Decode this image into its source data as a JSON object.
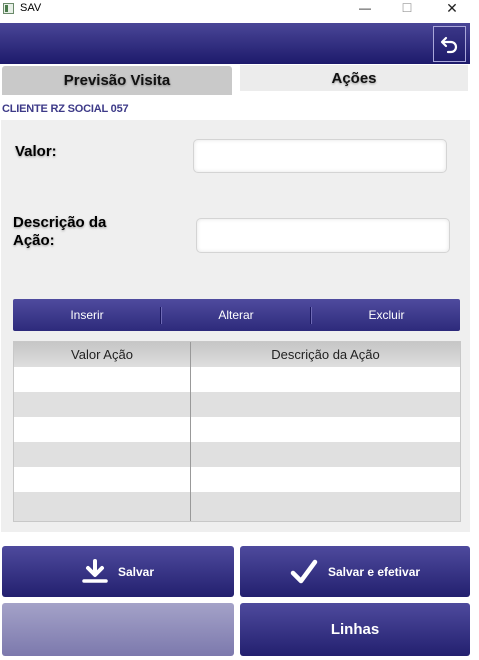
{
  "window": {
    "title": "SAV",
    "minimize": "—",
    "maximize": "☐",
    "close": "✕"
  },
  "header": {
    "back_icon": "undo-arrow-icon"
  },
  "tabs": [
    {
      "label": "Previsão Visita"
    },
    {
      "label": "Ações"
    }
  ],
  "client_name": "CLIENTE RZ SOCIAL 057",
  "form": {
    "valor_label": "Valor:",
    "valor_value": "",
    "descricao_label_line1": "Descrição da",
    "descricao_label_line2": "Ação:",
    "descricao_value": ""
  },
  "action_bar": {
    "inserir": "Inserir",
    "alterar": "Alterar",
    "excluir": "Excluir"
  },
  "grid": {
    "columns": [
      "Valor Ação",
      "Descrição da Ação"
    ],
    "rows": []
  },
  "buttons": {
    "salvar": "Salvar",
    "salvar_efetivar": "Salvar e efetivar",
    "disabled": "",
    "linhas": "Linhas"
  },
  "colors": {
    "primary": "#2d2a7b",
    "accent_text": "#3d3a88"
  }
}
